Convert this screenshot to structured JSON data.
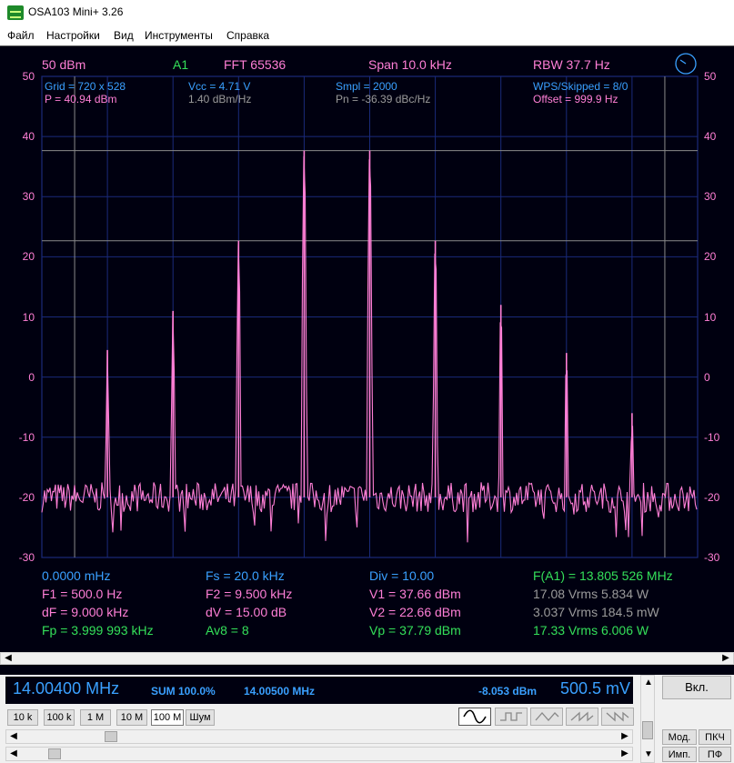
{
  "window": {
    "title": "OSA103 Mini+ 3.26"
  },
  "menu": [
    "Файл",
    "Настройки",
    "Вид",
    "Инструменты",
    "Справка"
  ],
  "header": {
    "ref_level": "50 dBm",
    "channel": "A1",
    "fft": "FFT  65536",
    "span": "Span 10.0 kHz",
    "rbw": "RBW 37.7 Hz"
  },
  "info": {
    "grid": "Grid = 720 x 528",
    "power": "P = 40.94 dBm",
    "vcc": "Vcc = 4.71 V",
    "density": "1.40 dBm/Hz",
    "smpl": "Smpl = 2000",
    "pn": "Pn = -36.39 dBc/Hz",
    "wps": "WPS/Skipped  = 8/0",
    "offset": "Offset = 999.9 Hz"
  },
  "readouts": {
    "f0": "0.0000 mHz",
    "fs": "Fs = 20.0 kHz",
    "div": "Div = 10.00",
    "fa1": "F(A1) = 13.805 526 MHz",
    "f1": "F1 = 500.0 Hz",
    "f2": "F2 = 9.500 kHz",
    "v1": "V1 = 37.66 dBm",
    "v1rms": "17.08 Vrms  5.834 W",
    "df": "dF = 9.000 kHz",
    "dv": "dV = 15.00 dB",
    "v2": "V2 = 22.66 dBm",
    "v2rms": "3.037 Vrms  184.5 mW",
    "fp": "Fp = 3.999 993 kHz",
    "av": "Av8 = 8",
    "vp": "Vp = 37.79 dBm",
    "vprms": "17.33 Vrms  6.006 W"
  },
  "y_ticks": [
    "50",
    "40",
    "30",
    "20",
    "10",
    "0",
    "-10",
    "-20",
    "-30"
  ],
  "colors": {
    "bg": "#000010",
    "trace": "#ff7fd6",
    "grid": "#1a2a7a",
    "cursor": "#8a8a8a",
    "green": "#34e05a",
    "cyan": "#3aa0ff",
    "pink": "#ff7fd6",
    "gray": "#9a9a9a"
  },
  "chart_data": {
    "type": "line",
    "x_range_hz": [
      0,
      10000
    ],
    "ylim": [
      -30,
      50
    ],
    "ylabel": "",
    "peaks": [
      {
        "freq_hz": 1000,
        "level_dbm": 4.5
      },
      {
        "freq_hz": 2000,
        "level_dbm": 11
      },
      {
        "freq_hz": 3000,
        "level_dbm": 22.66
      },
      {
        "freq_hz": 4000,
        "level_dbm": 37.66
      },
      {
        "freq_hz": 5000,
        "level_dbm": 37.66
      },
      {
        "freq_hz": 6000,
        "level_dbm": 22.66
      },
      {
        "freq_hz": 7000,
        "level_dbm": 12
      },
      {
        "freq_hz": 8000,
        "level_dbm": 4
      },
      {
        "freq_hz": 9000,
        "level_dbm": -6
      }
    ],
    "noise_floor_dbm": -20,
    "cursor_x_hz": [
      500,
      9500
    ],
    "cursor_y_dbm": [
      37.66,
      22.66
    ]
  },
  "bottom": {
    "freq_main": "14.00400 MHz",
    "sum": "SUM 100.0%",
    "freq_sum": "14.00500 MHz",
    "level": "-8.053 dBm",
    "voltage": "500.5 mV",
    "on_button": "Вкл.",
    "step_buttons": [
      "10 k",
      "100 k",
      "1 M",
      "10 M",
      "100 M",
      "Шум"
    ],
    "mode_buttons": [
      "Мод.",
      "ПКЧ",
      "Имп.",
      "ПФ"
    ]
  }
}
